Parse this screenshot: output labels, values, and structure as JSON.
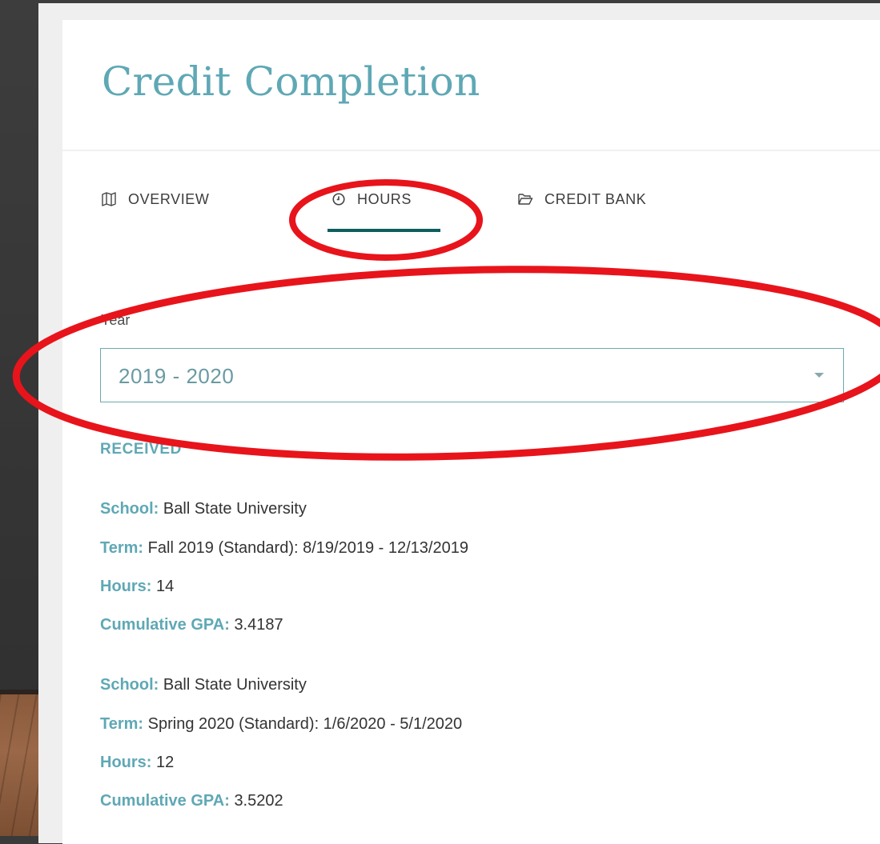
{
  "page": {
    "title": "Credit Completion"
  },
  "tabs": [
    {
      "label": "OVERVIEW",
      "icon": "map-icon"
    },
    {
      "label": "HOURS",
      "icon": "clock-icon",
      "active": true
    },
    {
      "label": "CREDIT BANK",
      "icon": "folder-icon"
    }
  ],
  "year_filter": {
    "label": "Year",
    "selected": "2019 - 2020"
  },
  "received": {
    "heading": "RECEIVED",
    "field_labels": {
      "school": "School:",
      "term": "Term:",
      "hours": "Hours:",
      "gpa": "Cumulative GPA:"
    },
    "records": [
      {
        "school": "Ball State University",
        "term": "Fall 2019 (Standard): 8/19/2019 - 12/13/2019",
        "hours": "14",
        "gpa": "3.4187"
      },
      {
        "school": "Ball State University",
        "term": "Spring 2020 (Standard): 1/6/2020 - 5/1/2020",
        "hours": "12",
        "gpa": "3.5202"
      }
    ]
  },
  "colors": {
    "accent": "#5fa8b5",
    "tab_underline": "#0f5e5e",
    "annotation": "#e8141b"
  }
}
